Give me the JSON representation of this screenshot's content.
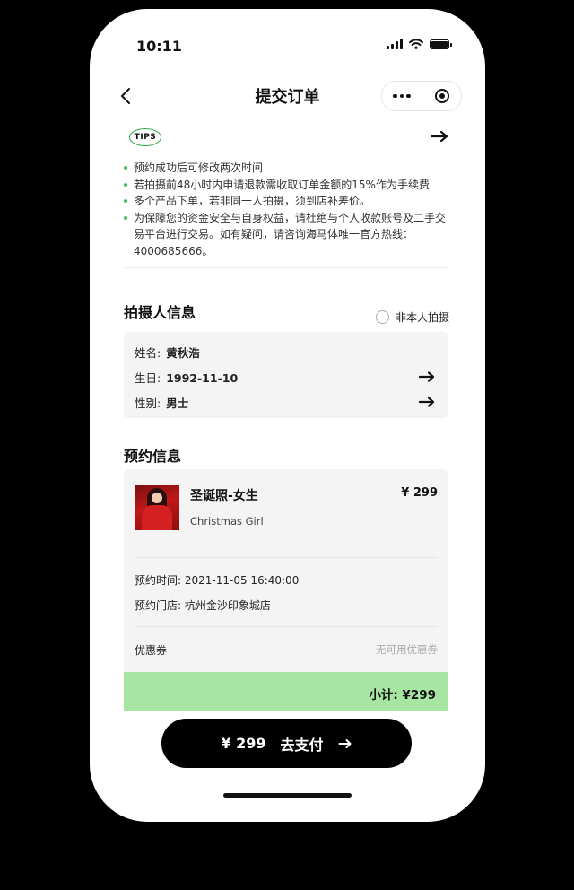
{
  "status": {
    "time": "10:11"
  },
  "nav": {
    "title": "提交订单"
  },
  "tips": {
    "badge": "TIPS",
    "items": [
      "预约成功后可修改两次时间",
      "若拍摄前48小时内申请退款需收取订单金额的15%作为手续费",
      "多个产品下单，若非同一人拍摄，须到店补差价。",
      "为保障您的资金安全与自身权益，请杜绝与个人收款账号及二手交易平台进行交易。如有疑问，请咨询海马体唯一官方热线：4000685666。"
    ]
  },
  "photographer": {
    "title": "拍摄人信息",
    "not_self_label": "非本人拍摄",
    "name_label": "姓名:",
    "name": "黄秋浩",
    "birthday_label": "生日:",
    "birthday": "1992-11-10",
    "gender_label": "性别:",
    "gender": "男士"
  },
  "booking": {
    "title": "预约信息",
    "product_name": "圣诞照-女生",
    "product_subtitle": "Christmas Girl",
    "price": "¥ 299",
    "time_label": "预约时间:",
    "time": "2021-11-05 16:40:00",
    "store_label": "预约门店:",
    "store": "杭州金沙印象城店",
    "coupon_label": "优惠券",
    "coupon_value": "无可用优惠券",
    "subtotal": "小计: ¥299"
  },
  "pay": {
    "amount": "¥ 299",
    "label": "去支付"
  },
  "colors": {
    "accent_green": "#a7e6a2",
    "tips_dot": "#3fbf5a",
    "pay_button": "#000000"
  },
  "icons": [
    "back-icon",
    "more-icon",
    "close-mini-program-icon",
    "arrow-right-icon",
    "radio-icon"
  ]
}
